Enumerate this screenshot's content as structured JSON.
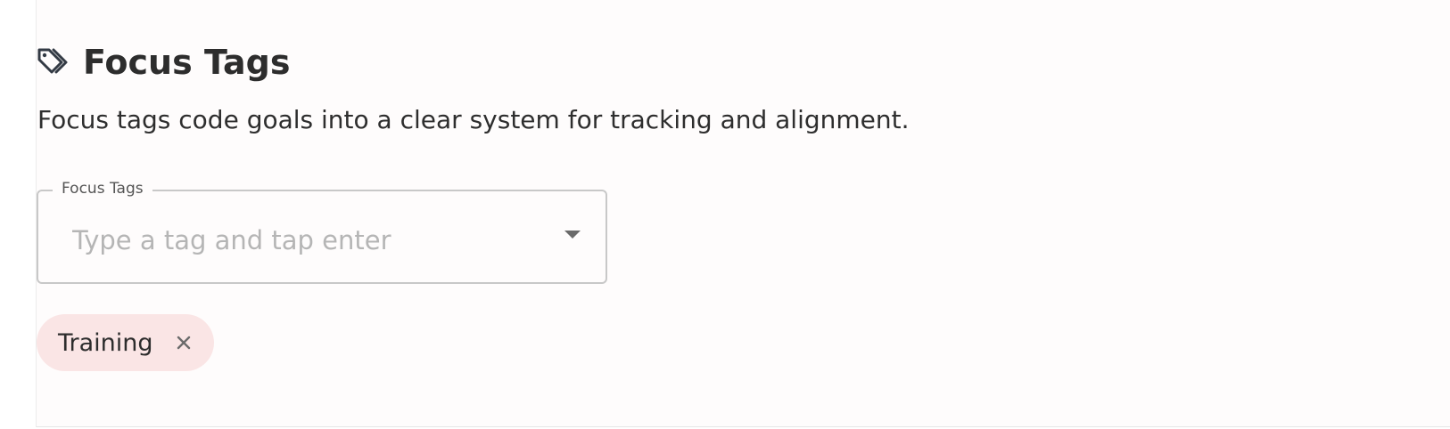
{
  "section": {
    "title": "Focus Tags",
    "icon": "tags-icon",
    "description": "Focus tags code goals into a clear system for tracking and alignment."
  },
  "tag_field": {
    "label": "Focus Tags",
    "value": "",
    "placeholder": "Type a tag and tap enter",
    "dropdown_icon": "caret-down-icon"
  },
  "selected_tags": [
    {
      "label": "Training",
      "remove_icon": "close-icon",
      "color": "#fae5e5"
    }
  ],
  "colors": {
    "text": "#2d2d2d",
    "border": "#c8c8c8",
    "chip_background": "#fae5e5",
    "panel_background": "#fefcfc"
  }
}
